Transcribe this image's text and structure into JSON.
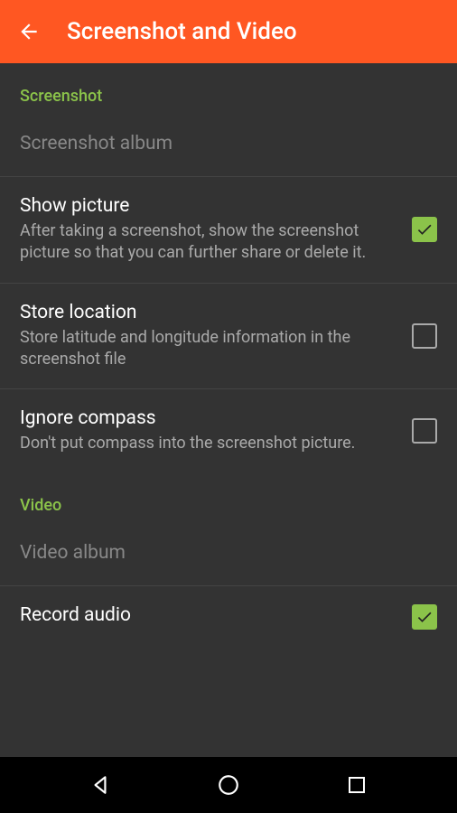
{
  "header": {
    "title": "Screenshot and Video"
  },
  "sections": {
    "screenshot": {
      "label": "Screenshot",
      "items": {
        "album": {
          "title": "Screenshot album"
        },
        "show_picture": {
          "title": "Show picture",
          "desc": "After taking a screenshot, show the screenshot picture so that you can further share or delete it."
        },
        "store_location": {
          "title": "Store location",
          "desc": "Store latitude and longitude information in the screenshot file"
        },
        "ignore_compass": {
          "title": "Ignore compass",
          "desc": "Don't put compass into the screenshot picture."
        }
      }
    },
    "video": {
      "label": "Video",
      "items": {
        "album": {
          "title": "Video album"
        },
        "record_audio": {
          "title": "Record audio"
        }
      }
    }
  }
}
